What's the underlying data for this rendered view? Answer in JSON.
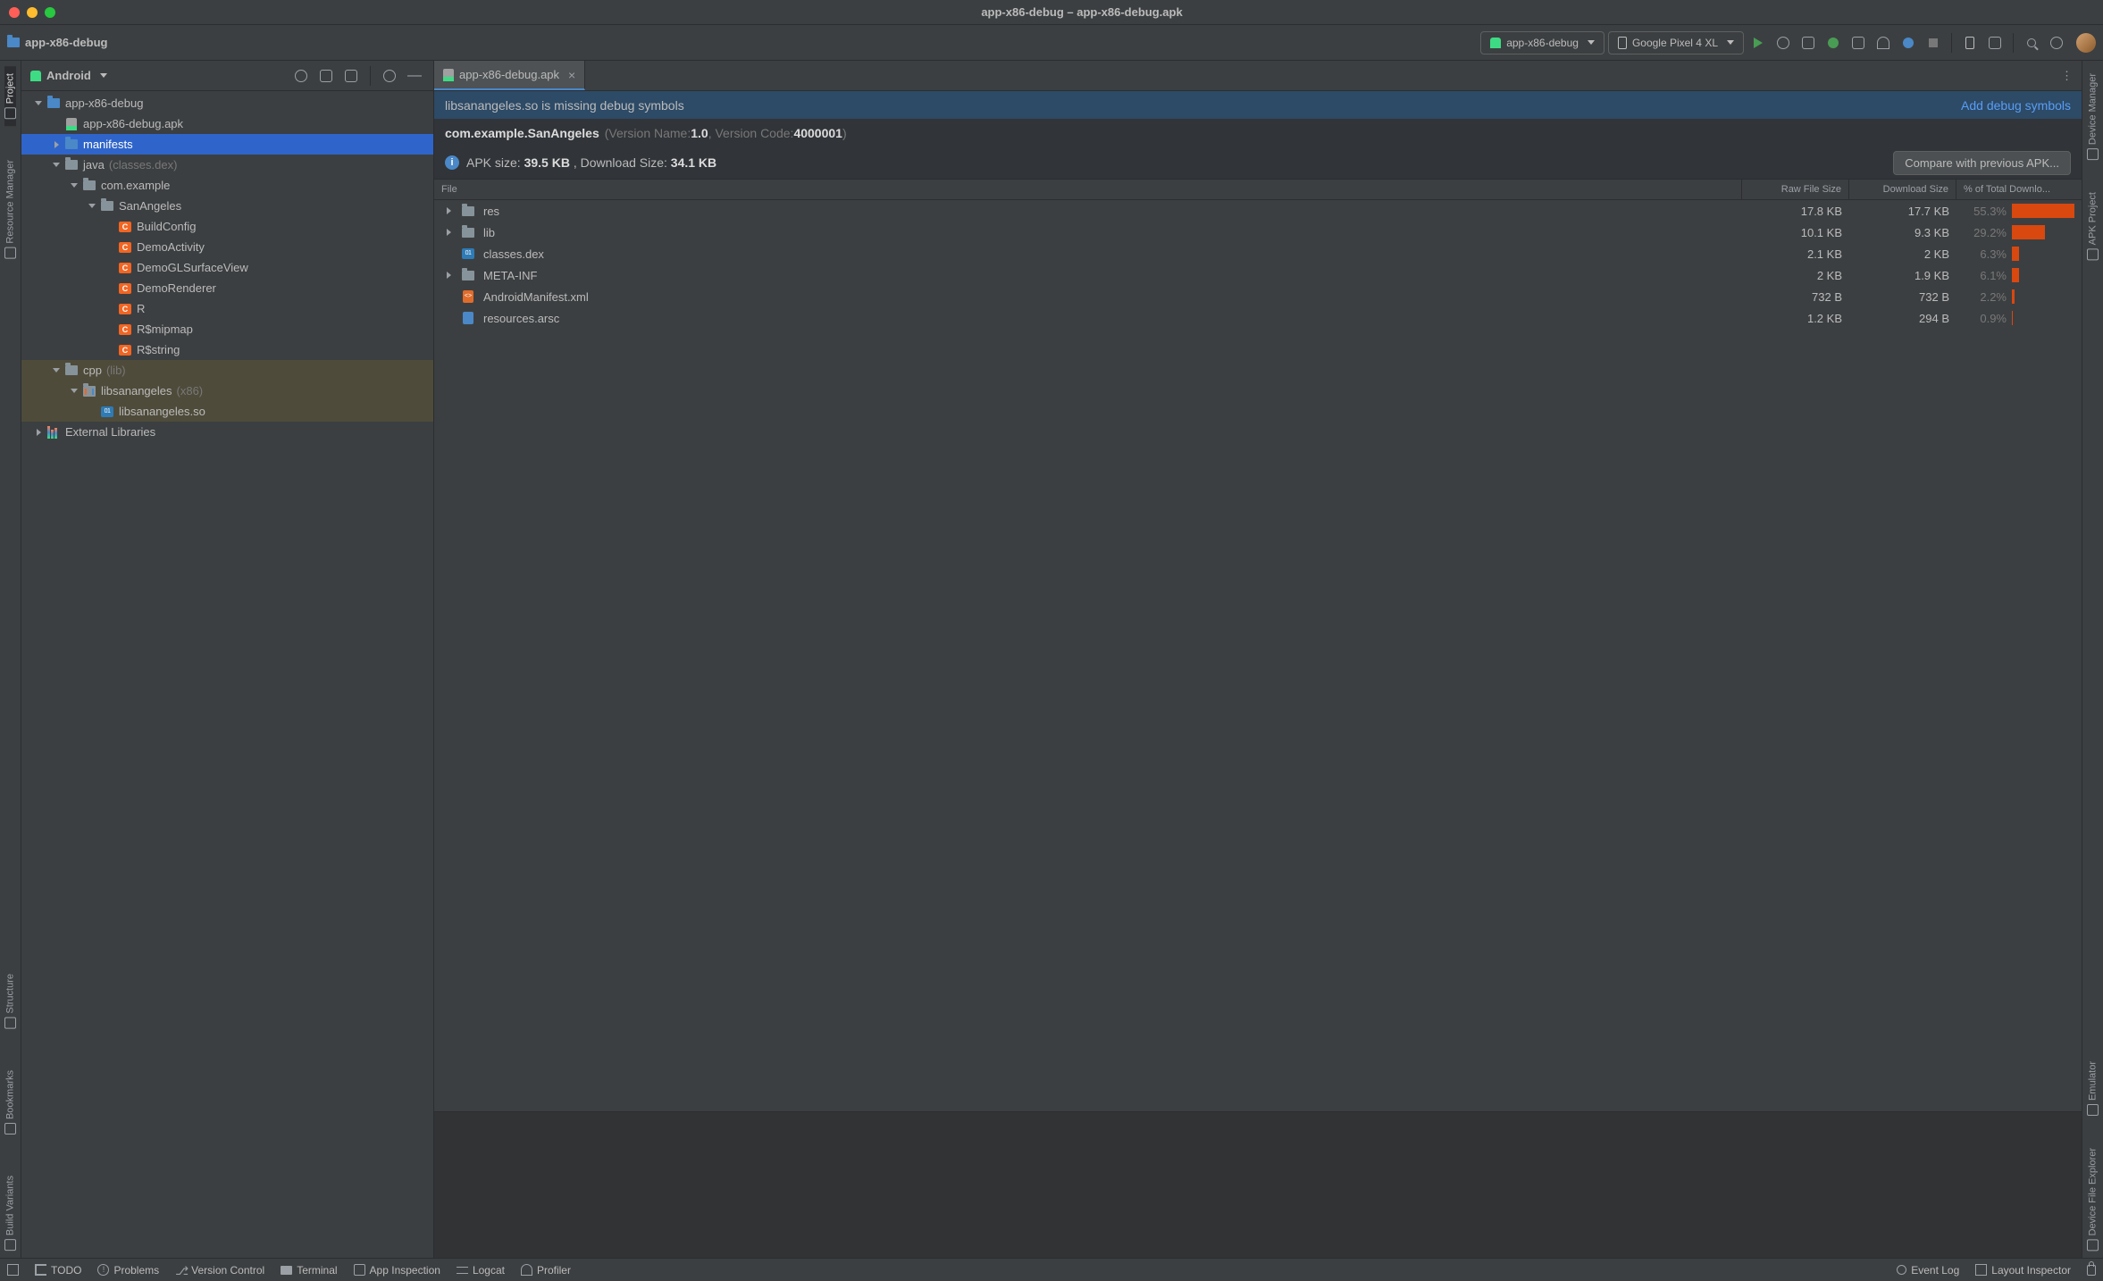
{
  "window": {
    "title": "app-x86-debug – app-x86-debug.apk",
    "breadcrumb": "app-x86-debug"
  },
  "toolbar": {
    "run_config": "app-x86-debug",
    "device": "Google Pixel 4 XL"
  },
  "left_gutter": [
    "Project",
    "Resource Manager",
    "Structure",
    "Bookmarks",
    "Build Variants"
  ],
  "right_gutter": [
    "Device Manager",
    "APK Project",
    "Emulator",
    "Device File Explorer"
  ],
  "project_panel": {
    "view": "Android",
    "tree": [
      {
        "d": 0,
        "exp": "open",
        "icon": "folder-blue",
        "label": "app-x86-debug"
      },
      {
        "d": 1,
        "exp": "",
        "icon": "apk",
        "label": "app-x86-debug.apk"
      },
      {
        "d": 1,
        "exp": "closed",
        "icon": "folder-blue",
        "label": "manifests",
        "selected": true
      },
      {
        "d": 1,
        "exp": "open",
        "icon": "folder",
        "label": "java",
        "qual": "(classes.dex)"
      },
      {
        "d": 2,
        "exp": "open",
        "icon": "folder",
        "label": "com.example"
      },
      {
        "d": 3,
        "exp": "open",
        "icon": "folder",
        "label": "SanAngeles"
      },
      {
        "d": 4,
        "exp": "",
        "icon": "class",
        "label": "BuildConfig"
      },
      {
        "d": 4,
        "exp": "",
        "icon": "class",
        "label": "DemoActivity"
      },
      {
        "d": 4,
        "exp": "",
        "icon": "class",
        "label": "DemoGLSurfaceView"
      },
      {
        "d": 4,
        "exp": "",
        "icon": "class",
        "label": "DemoRenderer"
      },
      {
        "d": 4,
        "exp": "",
        "icon": "class",
        "label": "R"
      },
      {
        "d": 4,
        "exp": "",
        "icon": "class",
        "label": "R$mipmap"
      },
      {
        "d": 4,
        "exp": "",
        "icon": "class",
        "label": "R$string"
      },
      {
        "d": 1,
        "exp": "open",
        "icon": "folder",
        "label": "cpp",
        "qual": "(lib)",
        "hl": true
      },
      {
        "d": 2,
        "exp": "open",
        "icon": "libjar",
        "label": "libsanangeles",
        "qual": "(x86)",
        "hl": true
      },
      {
        "d": 3,
        "exp": "",
        "icon": "so",
        "label": "libsanangeles.so",
        "hl": true
      },
      {
        "d": 0,
        "exp": "closed",
        "icon": "lib",
        "label": "External Libraries"
      }
    ]
  },
  "editor": {
    "tab": "app-x86-debug.apk",
    "warn": {
      "text": "libsanangeles.so is missing debug symbols",
      "link": "Add debug symbols"
    },
    "pkg": {
      "name": "com.example.SanAngeles",
      "vname_label": "(Version Name: ",
      "vname": "1.0",
      "vcode_label": ", Version Code: ",
      "vcode": "4000001",
      "close": ")"
    },
    "info": {
      "pre": "APK size: ",
      "apk": "39.5 KB",
      "mid": ", Download Size: ",
      "dl": "34.1 KB"
    },
    "compare_btn": "Compare with previous APK...",
    "cols": {
      "c0": "File",
      "c1": "Raw File Size",
      "c2": "Download Size",
      "c3": "% of Total Downlo..."
    },
    "rows": [
      {
        "exp": "closed",
        "icon": "folder",
        "name": "res",
        "raw": "17.8 KB",
        "dl": "17.7 KB",
        "pct": "55.3%",
        "bar": 55.3
      },
      {
        "exp": "closed",
        "icon": "folder",
        "name": "lib",
        "raw": "10.1 KB",
        "dl": "9.3 KB",
        "pct": "29.2%",
        "bar": 29.2
      },
      {
        "exp": "",
        "icon": "so",
        "name": "classes.dex",
        "raw": "2.1 KB",
        "dl": "2 KB",
        "pct": "6.3%",
        "bar": 6.3
      },
      {
        "exp": "closed",
        "icon": "folder",
        "name": "META-INF",
        "raw": "2 KB",
        "dl": "1.9 KB",
        "pct": "6.1%",
        "bar": 6.1
      },
      {
        "exp": "",
        "icon": "xml",
        "name": "AndroidManifest.xml",
        "raw": "732 B",
        "dl": "732 B",
        "pct": "2.2%",
        "bar": 2.2
      },
      {
        "exp": "",
        "icon": "arsc",
        "name": "resources.arsc",
        "raw": "1.2 KB",
        "dl": "294 B",
        "pct": "0.9%",
        "bar": 0.9
      }
    ]
  },
  "statusbar": {
    "items_left": [
      "TODO",
      "Problems",
      "Version Control",
      "Terminal",
      "App Inspection",
      "Logcat",
      "Profiler"
    ],
    "items_right": [
      "Event Log",
      "Layout Inspector"
    ]
  }
}
